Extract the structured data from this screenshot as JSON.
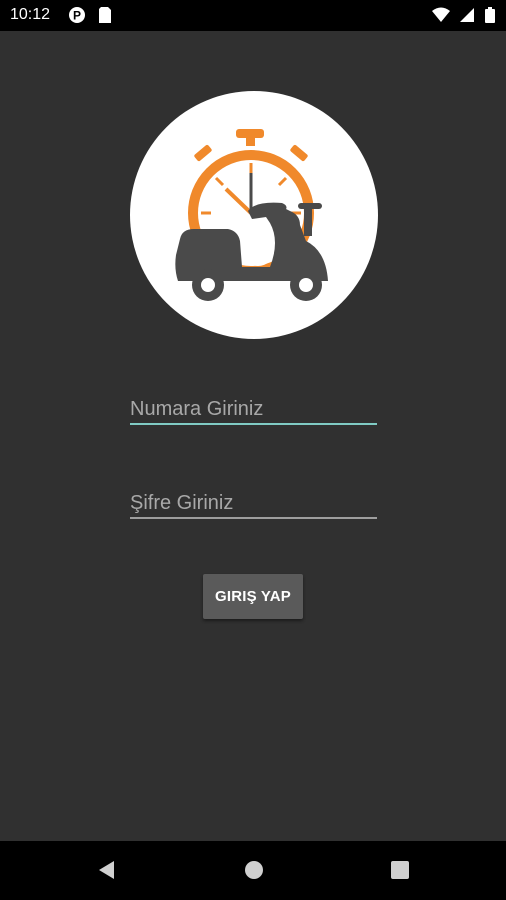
{
  "status_bar": {
    "time": "10:12",
    "left_icons": [
      "notification-p-icon",
      "sim-card-icon"
    ],
    "right_icons": [
      "wifi-icon",
      "signal-icon",
      "battery-icon"
    ]
  },
  "logo": {
    "description_icon": "scooter-stopwatch-logo",
    "colors": {
      "stopwatch": "#F0892B",
      "scooter": "#4A4A4A",
      "background": "#FFFFFF"
    }
  },
  "form": {
    "phone": {
      "placeholder": "Numara Giriniz",
      "value": ""
    },
    "password": {
      "placeholder": "Şifre Giriniz",
      "value": ""
    },
    "login_button_label": "GIRIŞ YAP"
  },
  "nav_bar": {
    "buttons": [
      "back-icon",
      "home-icon",
      "recents-icon"
    ]
  },
  "colors": {
    "background": "#303030",
    "accent_underline": "#80CBC4",
    "button_bg": "#5A5A5A"
  }
}
